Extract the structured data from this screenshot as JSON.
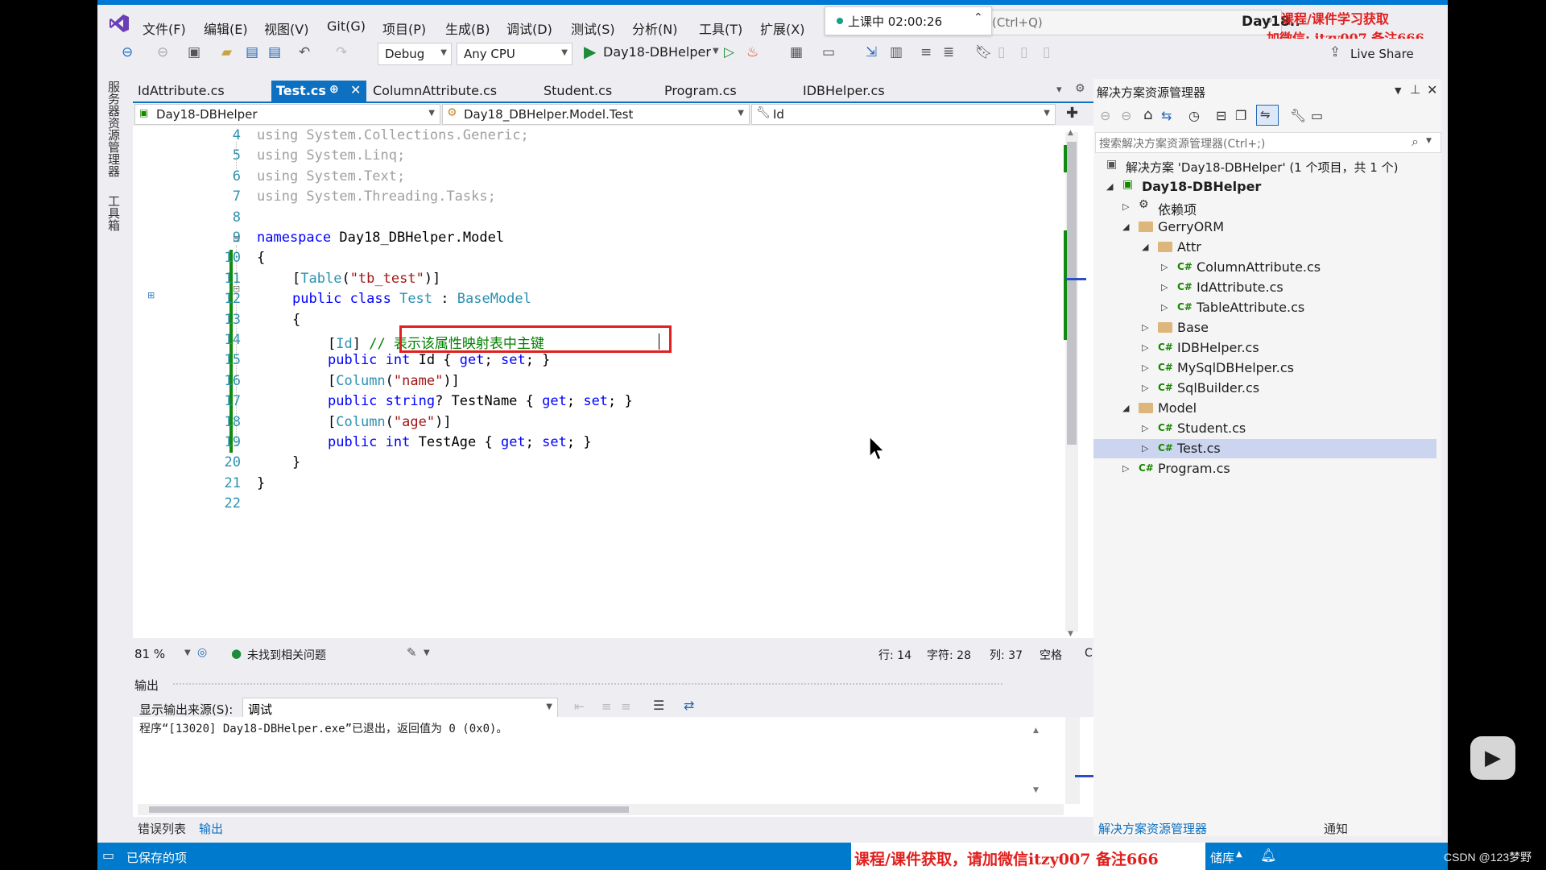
{
  "menu": {
    "items": [
      "文件(F)",
      "编辑(E)",
      "视图(V)",
      "Git(G)",
      "项目(P)",
      "生成(B)",
      "调试(D)",
      "测试(S)",
      "分析(N)",
      "工具(T)",
      "扩展(X)"
    ]
  },
  "recording": {
    "text": "上课中 02:00:26"
  },
  "search": {
    "placeholder": "(Ctrl+Q)"
  },
  "window_title": "Day18..",
  "watermark_top": {
    "line1": "课程/课件学习获取",
    "line2": "加微信: itzy007 备注666"
  },
  "toolbar": {
    "config": "Debug",
    "platform": "Any CPU",
    "run_target": "Day18-DBHelper",
    "live_share": "Live Share"
  },
  "left_strip": {
    "server_explorer": "服务器资源管理器",
    "toolbox": "工具箱"
  },
  "tabs": [
    {
      "label": "IdAttribute.cs"
    },
    {
      "label": "Test.cs"
    },
    {
      "label": "ColumnAttribute.cs"
    },
    {
      "label": "Student.cs"
    },
    {
      "label": "Program.cs"
    },
    {
      "label": "IDBHelper.cs"
    }
  ],
  "navbar": {
    "project": "Day18-DBHelper",
    "type": "Day18_DBHelper.Model.Test",
    "member": "Id"
  },
  "code": {
    "line_numbers": [
      "4",
      "5",
      "6",
      "7",
      "8",
      "9",
      "10",
      "11",
      "12",
      "13",
      "14",
      "15",
      "16",
      "17",
      "18",
      "19",
      "20",
      "21",
      "22"
    ],
    "l4": "using System.Collections.Generic;",
    "l5": "using System.Linq;",
    "l6": "using System.Text;",
    "l7": "using System.Threading.Tasks;",
    "l9_kw": "namespace",
    "l9_name": " Day18_DBHelper.Model",
    "l10": "{",
    "l11_a": "[",
    "l11_type": "Table",
    "l11_b": "(",
    "l11_str": "\"tb_test\"",
    "l11_c": ")]",
    "l12_kw": "public class",
    "l12_type": "Test",
    "l12_sep": " : ",
    "l12_base": "BaseModel",
    "l13": "{",
    "l14_a": "[",
    "l14_type": "Id",
    "l14_b": "] ",
    "l14_comment": "// 表示该属性映射表中主键",
    "l15_kw": "public int",
    "l15_rest": " Id { ",
    "l15_get": "get",
    "l15_semi": "; ",
    "l15_set": "set",
    "l15_end": "; }",
    "l16_a": "[",
    "l16_type": "Column",
    "l16_b": "(",
    "l16_str": "\"name\"",
    "l16_c": ")]",
    "l17_kw": "public string",
    "l17_rest": "? TestName { ",
    "l17_get": "get",
    "l17_semi": "; ",
    "l17_set": "set",
    "l17_end": "; }",
    "l18_a": "[",
    "l18_type": "Column",
    "l18_b": "(",
    "l18_str": "\"age\"",
    "l18_c": ")]",
    "l19_kw": "public int",
    "l19_rest": " TestAge { ",
    "l19_get": "get",
    "l19_semi": "; ",
    "l19_set": "set",
    "l19_end": "; }",
    "l20": "}",
    "l21": "}"
  },
  "editor_status": {
    "zoom": "81 %",
    "issues": "未找到相关问题",
    "line": "行: 14",
    "char": "字符: 28",
    "col": "列: 37",
    "space": "空格",
    "eol": "CRLF"
  },
  "output": {
    "title": "输出",
    "source_label": "显示输出来源(S):",
    "source_value": "调试",
    "text": "程序“[13020] Day18-DBHelper.exe”已退出，返回值为 0 (0x0)。"
  },
  "bottom_tabs": {
    "errors": "错误列表",
    "output": "输出"
  },
  "solution_explorer": {
    "title": "解决方案资源管理器",
    "search_placeholder": "搜索解决方案资源管理器(Ctrl+;)",
    "solution": "解决方案 'Day18-DBHelper' (1 个项目，共 1 个)",
    "project": "Day18-DBHelper",
    "deps": "依赖项",
    "gerry": "GerryORM",
    "attr": "Attr",
    "column_attr": "ColumnAttribute.cs",
    "id_attr": "IdAttribute.cs",
    "table_attr": "TableAttribute.cs",
    "base": "Base",
    "idbhelper": "IDBHelper.cs",
    "mysql": "MySqlDBHelper.cs",
    "sqlbuilder": "SqlBuilder.cs",
    "model": "Model",
    "student": "Student.cs",
    "test": "Test.cs",
    "program": "Program.cs",
    "bottom_tab_se": "解决方案资源管理器",
    "bottom_tab_notify": "通知"
  },
  "statusbar": {
    "saved": "已保存的项",
    "watermark": "课程/课件获取，请加微信itzy007 备注666",
    "repo": "储库",
    "csdn": "CSDN @123梦野"
  },
  "colors": {
    "accent": "#007acc",
    "highlight_box": "#e0201e",
    "tab_active": "#0e70c0"
  }
}
